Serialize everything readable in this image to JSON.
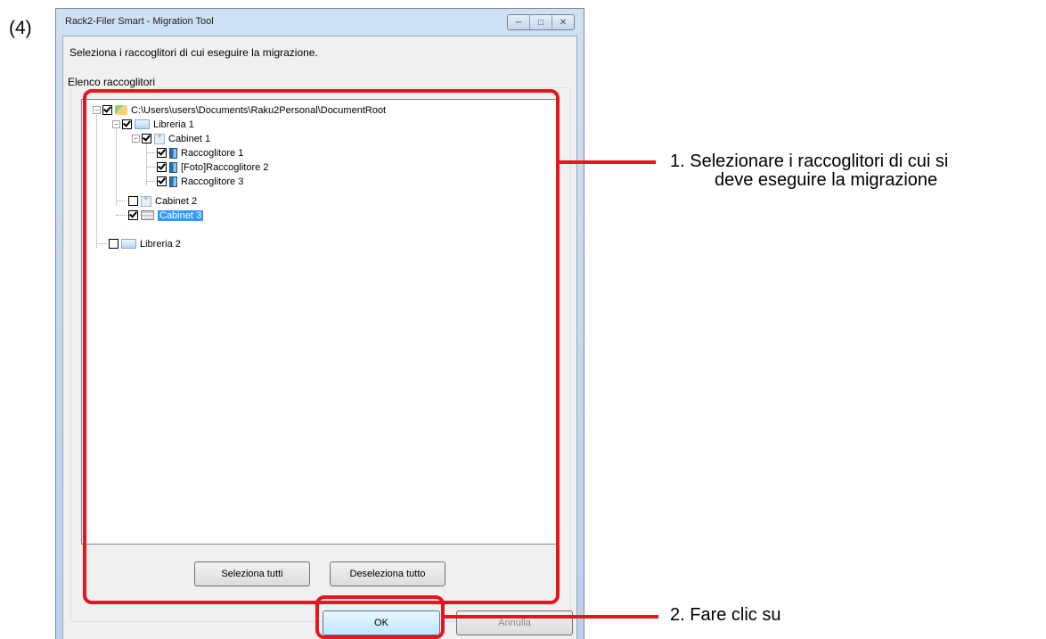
{
  "step": "(4)",
  "window": {
    "title": "Rack2-Filer Smart - Migration Tool",
    "buttons": [
      "minimize",
      "maximize",
      "close"
    ]
  },
  "instruction": "Seleziona i raccoglitori di cui eseguire la migrazione.",
  "group_label": "Elenco raccoglitori",
  "tree": {
    "root": "C:\\Users\\users\\Documents\\Raku2Personal\\DocumentRoot",
    "libreria1": "Libreria 1",
    "cabinet1": "Cabinet 1",
    "racc1": "Raccoglitore 1",
    "racc2": "[Foto]Raccoglitore 2",
    "racc3": "Raccoglitore 3",
    "cabinet2": "Cabinet 2",
    "cabinet3": "Cabinet 3",
    "libreria2": "Libreria 2"
  },
  "buttons": {
    "select_all": "Seleziona tutti",
    "deselect_all": "Deseleziona tutto",
    "ok": "OK",
    "cancel": "Annulla"
  },
  "callouts": {
    "first_line1": "1. Selezionare i raccoglitori di cui si",
    "first_line2": "deve eseguire la migrazione",
    "second": "2. Fare clic su"
  },
  "colors": {
    "highlight": "#e8151c",
    "selection": "#3399ff"
  }
}
